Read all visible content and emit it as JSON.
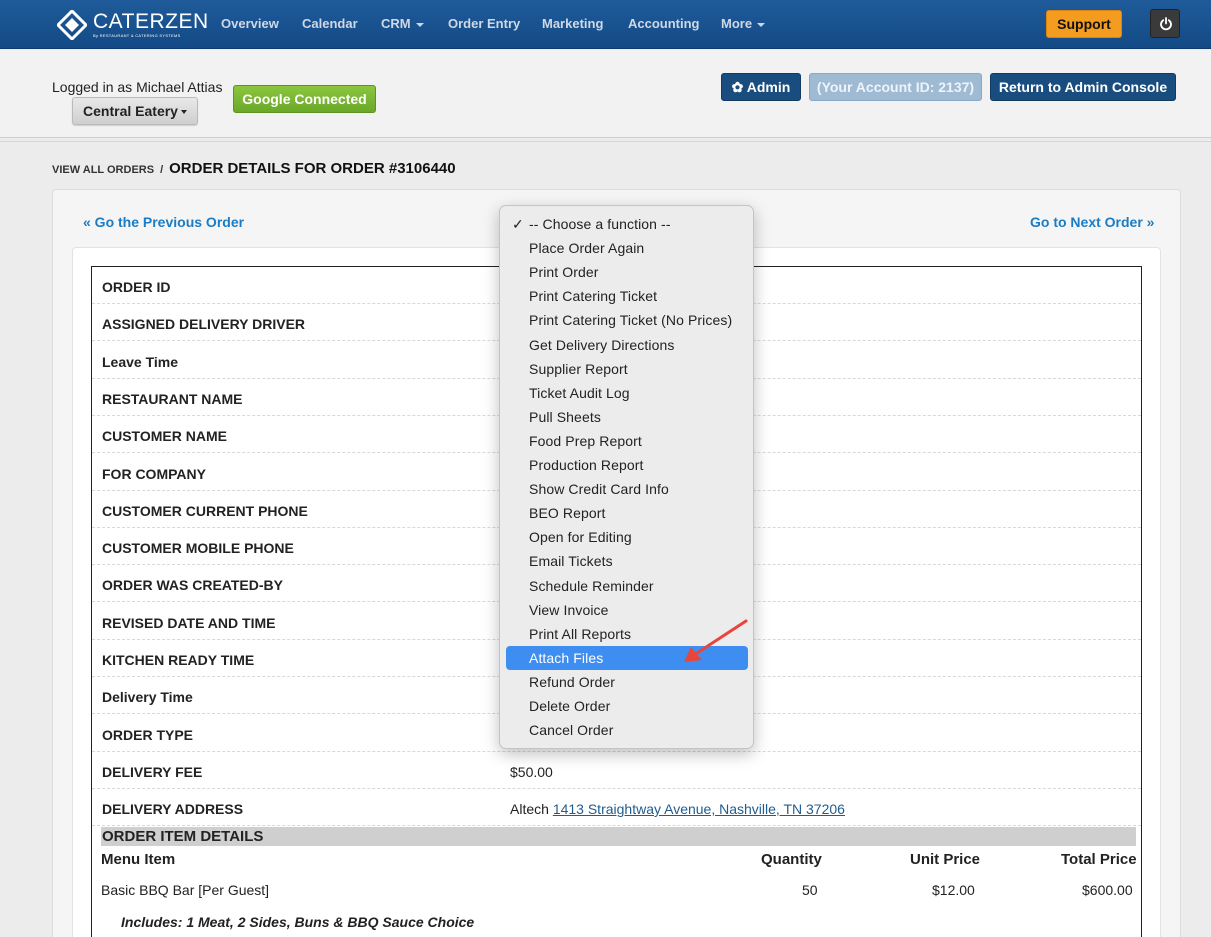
{
  "app": {
    "logo_text": "CATERZEN",
    "logo_sub": "By RESTAURANT & CATERING SYSTEMS"
  },
  "nav": {
    "items": [
      "Overview",
      "Calendar",
      "CRM",
      "Order Entry",
      "Marketing",
      "Accounting",
      "More"
    ],
    "support_label": "Support"
  },
  "header": {
    "logged_in": "Logged in as Michael Attias",
    "eatery": "Central Eatery",
    "google": "Google Connected",
    "admin": "Admin",
    "account_id": "(Your Account ID: 2137)",
    "return_console": "Return to Admin Console"
  },
  "breadcrumb": {
    "link": "VIEW ALL ORDERS",
    "separator": "/",
    "current": "ORDER DETAILS FOR ORDER #3106440"
  },
  "pager": {
    "prev": "« Go the Previous Order",
    "next": "Go to Next Order »"
  },
  "order_rows": [
    {
      "label": "ORDER ID",
      "value": ""
    },
    {
      "label": "ASSIGNED DELIVERY DRIVER",
      "value": ""
    },
    {
      "label": "Leave Time",
      "value": ""
    },
    {
      "label": "RESTAURANT NAME",
      "value": ""
    },
    {
      "label": "CUSTOMER NAME",
      "value": ""
    },
    {
      "label": "FOR COMPANY",
      "value": ""
    },
    {
      "label": "CUSTOMER CURRENT PHONE",
      "value": ""
    },
    {
      "label": "CUSTOMER MOBILE PHONE",
      "value": ""
    },
    {
      "label": "ORDER WAS CREATED-BY",
      "value": ""
    },
    {
      "label": "REVISED DATE AND TIME",
      "value": ""
    },
    {
      "label": "KITCHEN READY TIME",
      "value": ""
    },
    {
      "label": "Delivery Time",
      "value": ""
    },
    {
      "label": "ORDER TYPE",
      "value": ""
    },
    {
      "label": "DELIVERY FEE",
      "value": "$50.00"
    },
    {
      "label": "DELIVERY ADDRESS",
      "value": "Altech",
      "link": "1413 Straightway Avenue, Nashville, TN 37206"
    }
  ],
  "items_section": {
    "title": "ORDER ITEM DETAILS",
    "columns": [
      "Menu Item",
      "Quantity",
      "Unit Price",
      "Total Price"
    ],
    "rows": [
      {
        "item": "Basic BBQ Bar [Per Guest]",
        "quantity": "50",
        "unit_price": "$12.00",
        "total_price": "$600.00"
      }
    ],
    "includes": "Includes: 1 Meat, 2 Sides, Buns & BBQ Sauce Choice"
  },
  "function_menu": {
    "selected_index": 0,
    "highlighted_index": 18,
    "check_glyph": "✓",
    "options": [
      "-- Choose a function --",
      "Place Order Again",
      "Print Order",
      "Print Catering Ticket",
      "Print Catering Ticket (No Prices)",
      "Get Delivery Directions",
      "Supplier Report",
      "Ticket Audit Log",
      "Pull Sheets",
      "Food Prep Report",
      "Production Report",
      "Show Credit Card Info",
      "BEO Report",
      "Open for Editing",
      "Email Tickets",
      "Schedule Reminder",
      "View Invoice",
      "Print All Reports",
      "Attach Files",
      "Refund Order",
      "Delete Order",
      "Cancel Order"
    ]
  },
  "colors": {
    "nav_bg": "#1a5490",
    "support": "#f39c1f",
    "google": "#7ab536",
    "admin": "#1a4d7f",
    "highlight": "#3d8ef0",
    "link": "#1a7cc4",
    "annotation_arrow": "#e8453c"
  },
  "icons": {
    "admin": "gear-icon",
    "power": "power-icon",
    "annotation": "red-arrow-icon"
  }
}
